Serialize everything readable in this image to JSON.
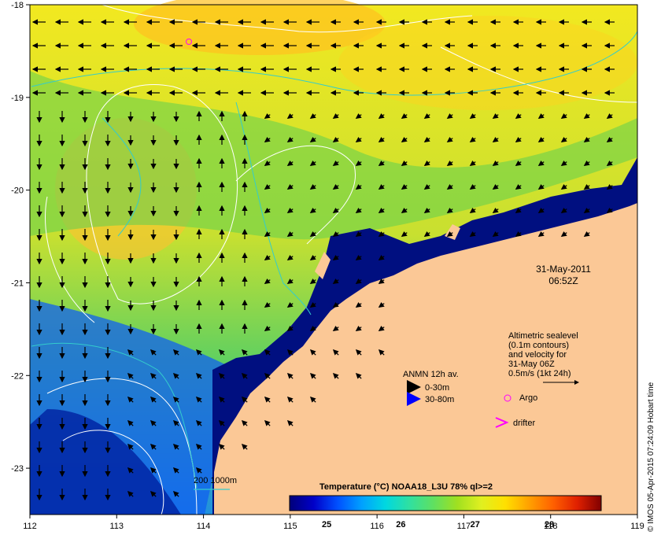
{
  "map": {
    "x_axis": {
      "range": [
        112,
        119
      ],
      "ticks": [
        "112",
        "113",
        "114",
        "115",
        "116",
        "117",
        "118",
        "119"
      ]
    },
    "y_axis": {
      "range": [
        -23.5,
        -18
      ],
      "ticks": [
        "-18",
        "-19",
        "-20",
        "-21",
        "-22",
        "-23"
      ]
    },
    "date_line1": "31-May-2011",
    "date_line2": "06:52Z",
    "sealevel_info": [
      "Altimetric sealevel",
      "(0.1m contours)",
      "and velocity for",
      "31-May 06Z",
      "0.5m/s (1kt 24h)"
    ],
    "anmn_title": "ANMN 12h av.",
    "anmn_items": [
      {
        "label": "0-30m",
        "color": "#000000"
      },
      {
        "label": "30-80m",
        "color": "#0000ff"
      }
    ],
    "argo_label": "Argo",
    "argo_color": "#ff00ff",
    "drifter_label": "drifter",
    "drifter_color": "#ff00ff",
    "depth_legend": "200  1000m",
    "depth_line_color": "#33cccc",
    "colorbar": {
      "title": "Temperature (°C) NOAA18_L3U 78% ql>=2",
      "range": [
        24.5,
        28.7
      ],
      "ticks": [
        "25",
        "26",
        "27",
        "28"
      ],
      "colors": [
        "#00007a",
        "#0000c8",
        "#0050ff",
        "#00a0ff",
        "#00d8e0",
        "#30e0a0",
        "#60e060",
        "#a0e020",
        "#e0f020",
        "#ffe000",
        "#ffa000",
        "#ff6000",
        "#e02000",
        "#800000"
      ]
    },
    "credit": "© IMOS 05-Apr-2015 07:24:09 Hobart time",
    "land_color": "#fbc896"
  }
}
